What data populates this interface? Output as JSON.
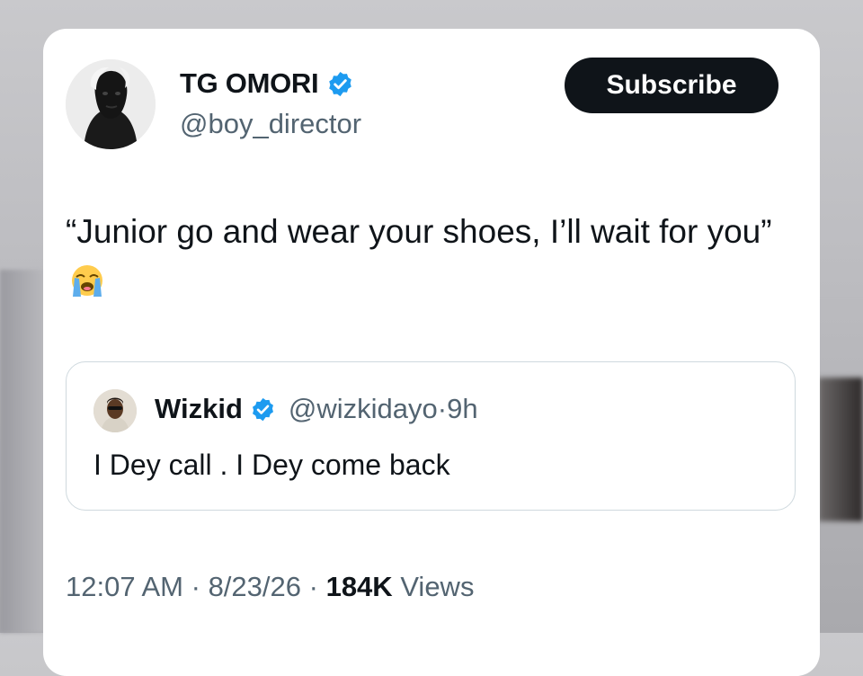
{
  "author": {
    "name": "TG OMORI",
    "handle": "@boy_director",
    "verified": true,
    "avatar_icon": "profile-photo-avatar"
  },
  "subscribe_label": "Subscribe",
  "tweet": {
    "text": "“Junior go and wear your shoes, I’ll wait for you”",
    "emoji_icon": "loudly-crying-face-emoji"
  },
  "quote": {
    "name": "Wizkid",
    "handle": "@wizkidayo",
    "separator": "·",
    "time": "9h",
    "text": "I Dey call . I Dey come back",
    "verified": true
  },
  "meta": {
    "time": "12:07 AM",
    "date": "8/23/26",
    "views_count": "184K",
    "views_label": "Views",
    "separator": "·"
  },
  "colors": {
    "verified_blue": "#1d9bf0",
    "text_primary": "#0f1419",
    "text_secondary": "#536471",
    "button_bg": "#0f1419",
    "border": "#cfd9de"
  }
}
